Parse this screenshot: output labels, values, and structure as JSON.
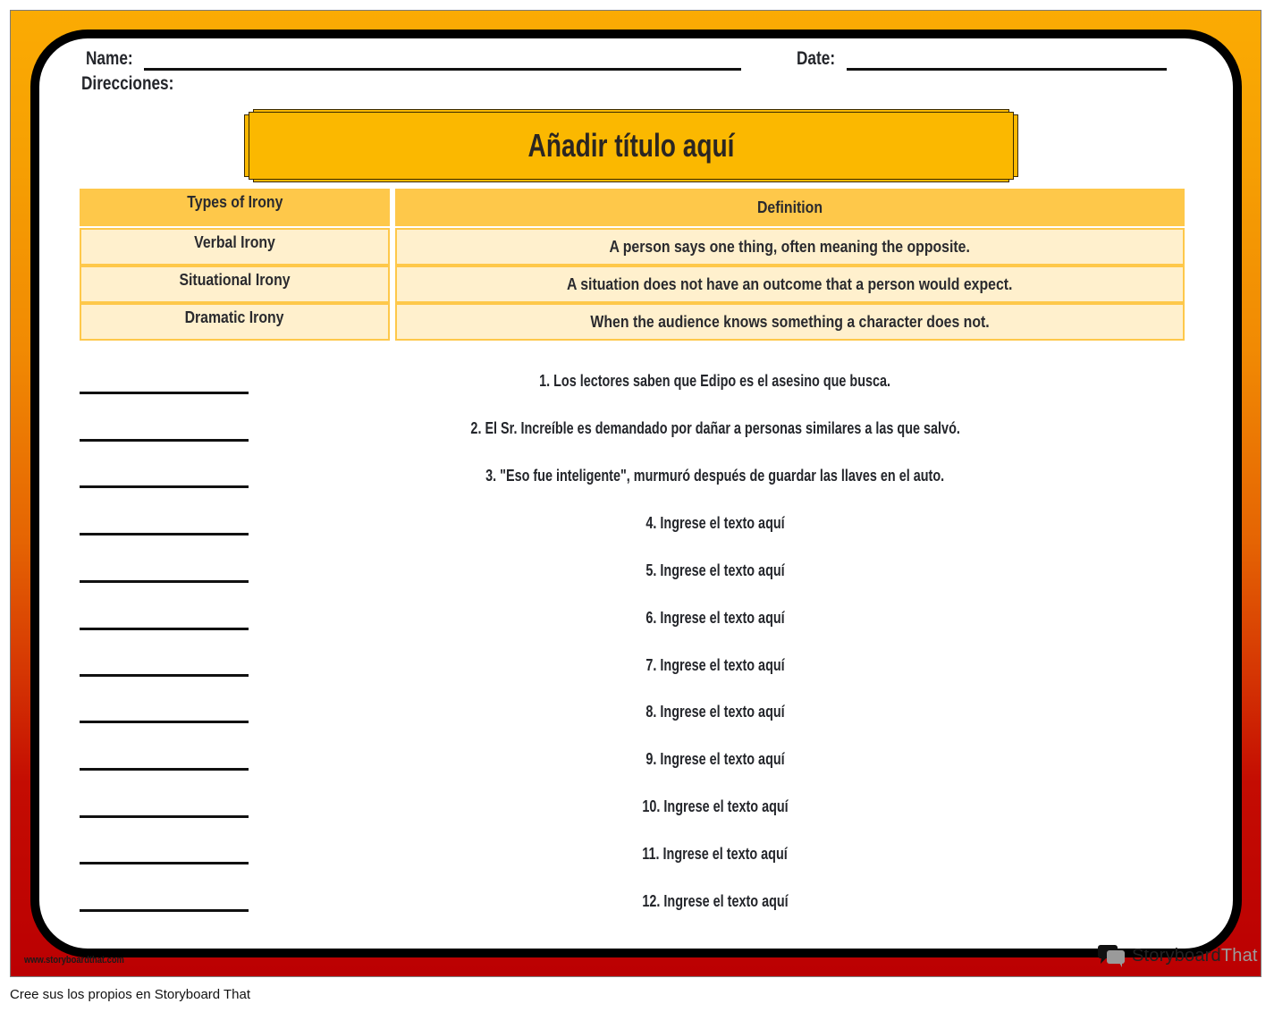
{
  "worksheet": {
    "name_label": "Name:",
    "date_label": "Date:",
    "directions_label": "Direcciones:",
    "title": "Añadir título aquí",
    "table": {
      "headers": [
        "Types of Irony",
        "Definition"
      ],
      "rows": [
        {
          "type": "Verbal Irony",
          "definition": "A person says one thing, often meaning the opposite."
        },
        {
          "type": "Situational Irony",
          "definition": "A situation does not have an outcome that a person would expect."
        },
        {
          "type": "Dramatic Irony",
          "definition": "When the audience knows something a character does not."
        }
      ]
    },
    "questions": [
      "1. Los lectores saben que Edipo es el asesino que busca.",
      "2. El Sr. Increíble es demandado por dañar a personas similares a las que salvó.",
      "3. \"Eso fue inteligente\", murmuró después de guardar las llaves en el auto.",
      "4. Ingrese el texto aquí",
      "5. Ingrese el texto aquí",
      "6. Ingrese el texto aquí",
      "7. Ingrese el texto aquí",
      "8. Ingrese el texto aquí",
      "9. Ingrese el texto aquí",
      "10. Ingrese el texto aquí",
      "11. Ingrese el texto aquí",
      "12. Ingrese el texto aquí"
    ]
  },
  "branding": {
    "site_url": "www.storyboardthat.com",
    "logo_text_dark": "Storyboard",
    "logo_text_light": "That",
    "logo_icon": "speech-bubbles-icon"
  },
  "footer": {
    "caption": "Cree sus los propios en Storyboard That"
  },
  "colors": {
    "gradient_top": "#fbab03",
    "gradient_bottom": "#bb0002",
    "title_fill": "#fbb800",
    "table_header": "#fec84a",
    "table_cell": "#fff0cd"
  }
}
